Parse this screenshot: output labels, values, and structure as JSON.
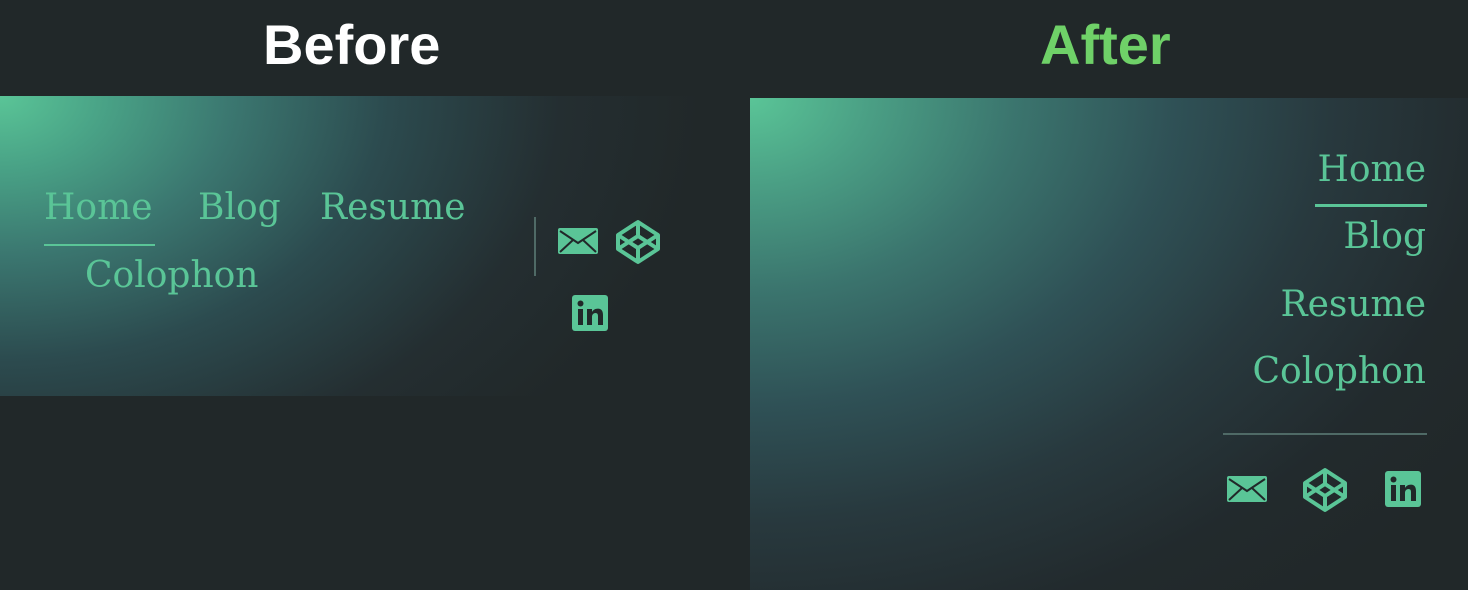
{
  "before": {
    "heading": "Before",
    "nav": [
      "Home",
      "Blog",
      "Resume",
      "Colophon"
    ],
    "active": "Home",
    "icons": [
      "mail-icon",
      "codepen-icon",
      "linkedin-icon"
    ]
  },
  "after": {
    "heading": "After",
    "nav": [
      "Home",
      "Blog",
      "Resume",
      "Colophon"
    ],
    "active": "Home",
    "icons": [
      "mail-icon",
      "codepen-icon",
      "linkedin-icon"
    ]
  },
  "colors": {
    "background": "#212829",
    "accent": "#5ac597",
    "heading_before": "#ffffff",
    "heading_after": "#6fd168",
    "divider": "#4f6a66"
  }
}
